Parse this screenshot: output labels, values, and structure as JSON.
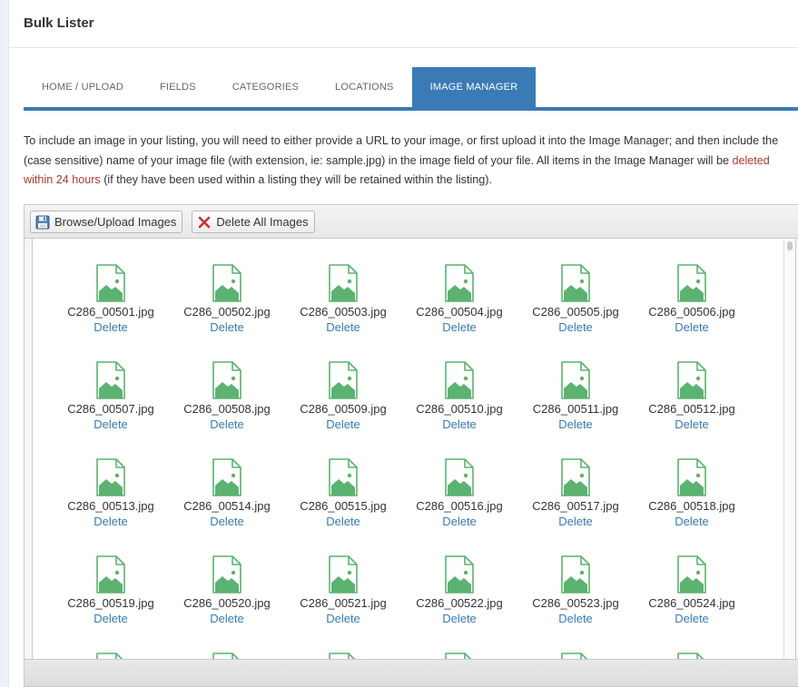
{
  "panel": {
    "title": "Bulk Lister"
  },
  "tabs": [
    {
      "label": "HOME / UPLOAD",
      "active": false
    },
    {
      "label": "FIELDS",
      "active": false
    },
    {
      "label": "CATEGORIES",
      "active": false
    },
    {
      "label": "LOCATIONS",
      "active": false
    },
    {
      "label": "IMAGE MANAGER",
      "active": true
    }
  ],
  "intro": {
    "part1": "To include an image in your listing, you will need to either provide a URL to your image, or first upload it into the Image Manager; and then include the (case sensitive) name of your image file (with extension, ie: sample.jpg) in the image field of your file. All items in the Image Manager will be ",
    "warning": "deleted within 24 hours",
    "part2": " (if they have been used within a listing they will be retained within the listing)."
  },
  "toolbar": {
    "browse_label": "Browse/Upload Images",
    "delete_all_label": "Delete All Images"
  },
  "files": [
    {
      "name": "C286_00501.jpg",
      "action": "Delete"
    },
    {
      "name": "C286_00502.jpg",
      "action": "Delete"
    },
    {
      "name": "C286_00503.jpg",
      "action": "Delete"
    },
    {
      "name": "C286_00504.jpg",
      "action": "Delete"
    },
    {
      "name": "C286_00505.jpg",
      "action": "Delete"
    },
    {
      "name": "C286_00506.jpg",
      "action": "Delete"
    },
    {
      "name": "C286_00507.jpg",
      "action": "Delete"
    },
    {
      "name": "C286_00508.jpg",
      "action": "Delete"
    },
    {
      "name": "C286_00509.jpg",
      "action": "Delete"
    },
    {
      "name": "C286_00510.jpg",
      "action": "Delete"
    },
    {
      "name": "C286_00511.jpg",
      "action": "Delete"
    },
    {
      "name": "C286_00512.jpg",
      "action": "Delete"
    },
    {
      "name": "C286_00513.jpg",
      "action": "Delete"
    },
    {
      "name": "C286_00514.jpg",
      "action": "Delete"
    },
    {
      "name": "C286_00515.jpg",
      "action": "Delete"
    },
    {
      "name": "C286_00516.jpg",
      "action": "Delete"
    },
    {
      "name": "C286_00517.jpg",
      "action": "Delete"
    },
    {
      "name": "C286_00518.jpg",
      "action": "Delete"
    },
    {
      "name": "C286_00519.jpg",
      "action": "Delete"
    },
    {
      "name": "C286_00520.jpg",
      "action": "Delete"
    },
    {
      "name": "C286_00521.jpg",
      "action": "Delete"
    },
    {
      "name": "C286_00522.jpg",
      "action": "Delete"
    },
    {
      "name": "C286_00523.jpg",
      "action": "Delete"
    },
    {
      "name": "C286_00524.jpg",
      "action": "Delete"
    },
    {
      "name": "",
      "action": ""
    },
    {
      "name": "",
      "action": ""
    },
    {
      "name": "",
      "action": ""
    },
    {
      "name": "",
      "action": ""
    },
    {
      "name": "",
      "action": ""
    },
    {
      "name": "",
      "action": ""
    }
  ],
  "icons": {
    "browse": "floppy-disk-icon",
    "delete_all": "red-x-icon",
    "file": "image-file-icon"
  },
  "colors": {
    "accent": "#3a7bb5",
    "warning": "#b03a2e",
    "file_icon": "#5cb270"
  }
}
